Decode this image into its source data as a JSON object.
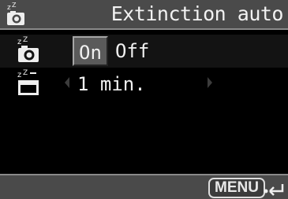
{
  "header": {
    "title": "Extinction auto",
    "icon": "camera-sleep-icon"
  },
  "rows": [
    {
      "icon": "camera-sleep-icon",
      "options": [
        "On",
        "Off"
      ],
      "selected": "On"
    },
    {
      "icon": "timer-sleep-icon",
      "value": "1 min."
    }
  ],
  "footer": {
    "menu_label": "MENU",
    "return_icon": "return-arrow-icon"
  },
  "colors": {
    "header_bg": "#4a4a4a",
    "selected_row_bg": "#131313",
    "selected_option_bg": "#5a5a5a",
    "text": "#f0f0f0"
  }
}
